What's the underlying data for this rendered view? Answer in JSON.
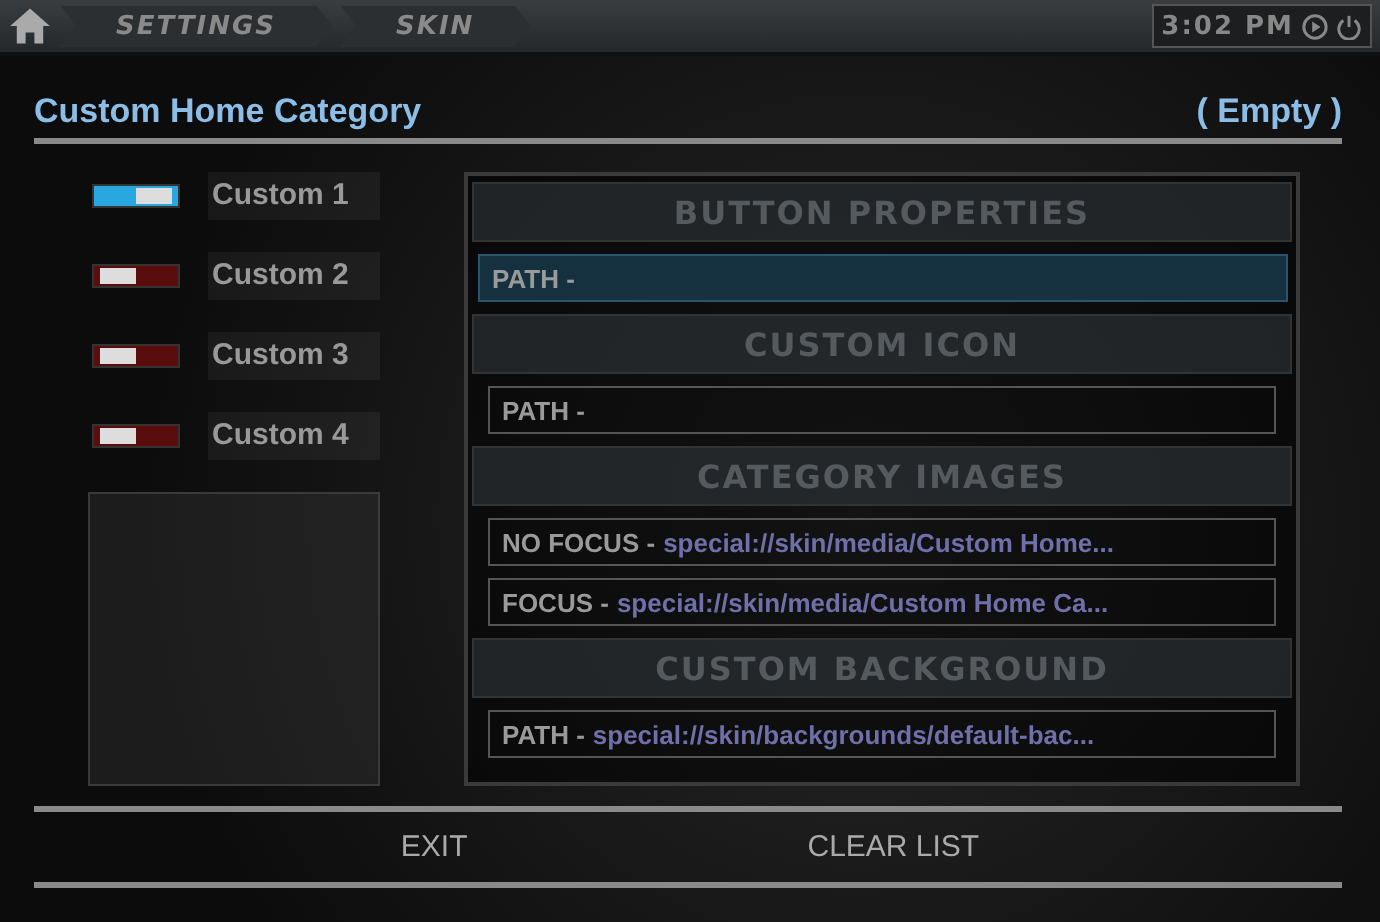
{
  "top_bar": {
    "breadcrumbs": [
      "SETTINGS",
      "SKIN"
    ],
    "clock": "3:02 PM"
  },
  "header": {
    "title": "Custom Home Category",
    "status": "( Empty )"
  },
  "categories": [
    {
      "label": "Custom 1",
      "selected": true
    },
    {
      "label": "Custom 2",
      "selected": false
    },
    {
      "label": "Custom 3",
      "selected": false
    },
    {
      "label": "Custom 4",
      "selected": false
    }
  ],
  "properties": [
    {
      "kind": "header",
      "label": "BUTTON PROPERTIES"
    },
    {
      "kind": "field",
      "label": "PATH -",
      "focused": true
    },
    {
      "kind": "header",
      "label": "CUSTOM ICON"
    },
    {
      "kind": "field",
      "label": "PATH -",
      "focused": false
    },
    {
      "kind": "header",
      "label": "CATEGORY IMAGES"
    },
    {
      "kind": "field",
      "label": "NO FOCUS -",
      "value": "special://skin/media/Custom Home...",
      "focused": false
    },
    {
      "kind": "field",
      "label": "FOCUS -",
      "value": "special://skin/media/Custom Home Ca...",
      "focused": false
    },
    {
      "kind": "header",
      "label": "CUSTOM BACKGROUND"
    },
    {
      "kind": "field",
      "label": "PATH -",
      "value": "special://skin/backgrounds/default-bac...",
      "focused": false
    }
  ],
  "buttons": [
    "EXIT",
    "CLEAR LIST"
  ]
}
